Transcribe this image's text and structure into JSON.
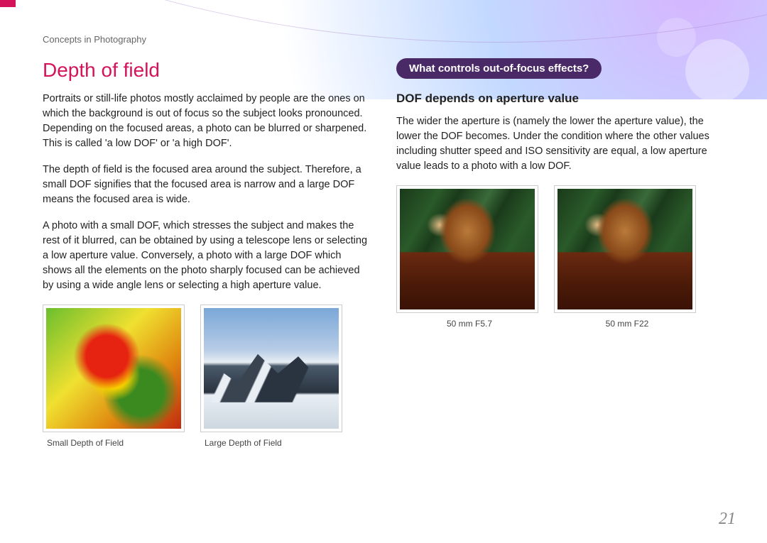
{
  "breadcrumb": "Concepts in Photography",
  "title": "Depth of field",
  "left_paragraphs": [
    "Portraits or still-life photos mostly acclaimed by people are the ones on which the background is out of focus so the subject looks pronounced. Depending on the focused areas, a photo can be blurred or sharpened. This is called 'a low DOF' or 'a high DOF'.",
    "The depth of field is the focused area around the subject. Therefore, a small DOF signifies that the focused area is narrow and a large DOF means the focused area is wide.",
    "A photo with a small DOF, which stresses the subject and makes the rest of it blurred, can be obtained by using a telescope lens or selecting a low aperture value. Conversely, a photo with a large DOF which shows all the elements on the photo sharply focused can be achieved by using a wide angle lens or selecting a high aperture value."
  ],
  "left_images": [
    {
      "caption": "Small Depth of Field"
    },
    {
      "caption": "Large Depth of Field"
    }
  ],
  "pill": "What controls out-of-focus effects?",
  "subheading": "DOF depends on aperture value",
  "right_paragraph": "The wider the aperture is (namely the lower the aperture value), the lower the DOF becomes. Under the condition where the other values including shutter speed and ISO sensitivity are equal, a low aperture value leads to a photo with a low DOF.",
  "right_images": [
    {
      "caption": "50 mm F5.7"
    },
    {
      "caption": "50 mm F22"
    }
  ],
  "page_number": "21"
}
